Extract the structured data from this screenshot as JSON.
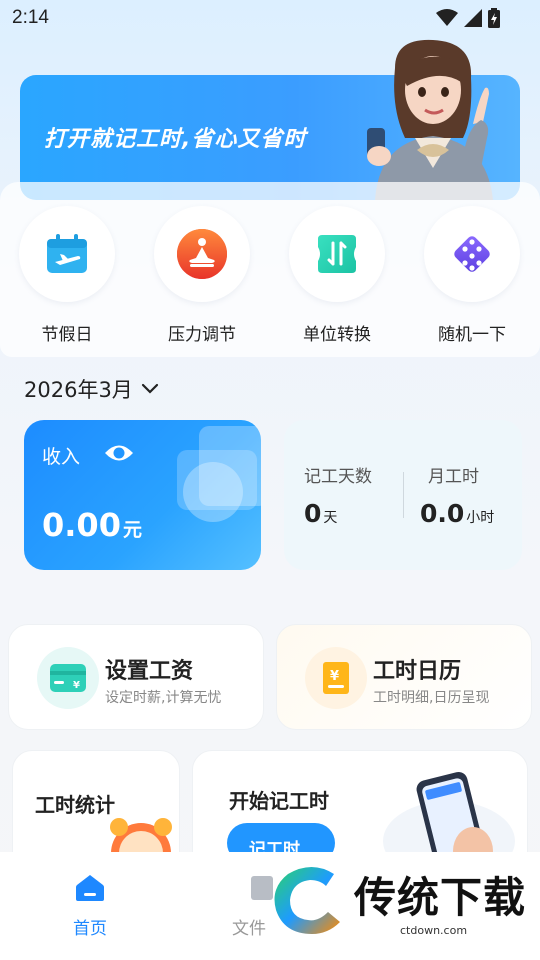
{
  "status": {
    "time": "2:14"
  },
  "banner": {
    "text": "打开就记工时,省心又省时"
  },
  "quick_actions": [
    {
      "label": "节假日",
      "icon": "calendar-plane-icon"
    },
    {
      "label": "压力调节",
      "icon": "meditation-icon"
    },
    {
      "label": "单位转换",
      "icon": "convert-icon"
    },
    {
      "label": "随机一下",
      "icon": "dice-icon"
    }
  ],
  "month": "2026年3月",
  "income": {
    "label": "收入",
    "value": "0.00",
    "unit": "元"
  },
  "stats": {
    "days_label": "记工天数",
    "days_value": "0",
    "days_unit": "天",
    "hours_label": "月工时",
    "hours_value": "0.0",
    "hours_unit": "小时"
  },
  "features": [
    {
      "title": "设置工资",
      "subtitle": "设定时薪,计算无忧"
    },
    {
      "title": "工时日历",
      "subtitle": "工时明细,日历呈现"
    }
  ],
  "bottom_cards": {
    "stats_title": "工时统计",
    "start_title": "开始记工时",
    "start_button": "记工时"
  },
  "tabs": {
    "home": "首页",
    "files": "文件"
  },
  "watermark": {
    "text": "传统下载",
    "url": "ctdown.com"
  },
  "colors": {
    "accent": "#1e88ff",
    "banner": "#2aa6ff"
  }
}
